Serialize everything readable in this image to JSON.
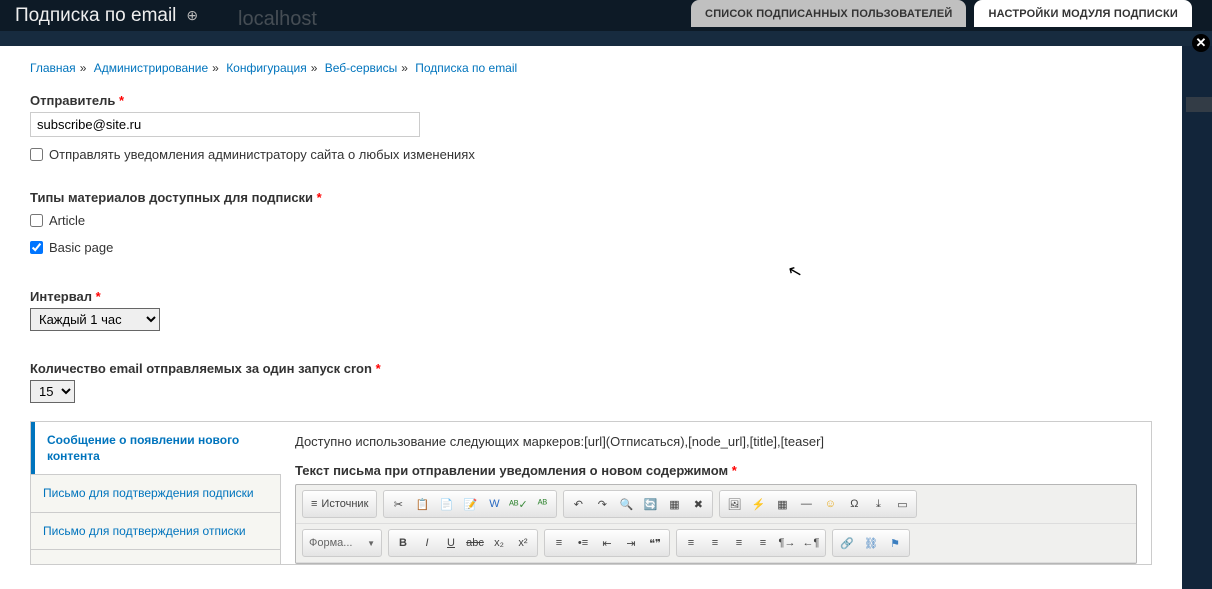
{
  "header": {
    "title": "Подписка по email",
    "plus_icon": "⊕",
    "host": "localhost",
    "tabs": [
      {
        "label": "СПИСОК ПОДПИСАННЫХ ПОЛЬЗОВАТЕЛЕЙ",
        "active": false
      },
      {
        "label": "НАСТРОЙКИ МОДУЛЯ ПОДПИСКИ",
        "active": true
      }
    ]
  },
  "breadcrumbs": [
    "Главная",
    "Администрирование",
    "Конфигурация",
    "Веб-сервисы",
    "Подписка по email"
  ],
  "sender": {
    "label": "Отправитель",
    "value": "subscribe@site.ru"
  },
  "notify_admin": {
    "label": "Отправлять уведомления администратору сайта о любых изменениях",
    "checked": false
  },
  "content_types": {
    "label": "Типы материалов доступных для подписки",
    "options": [
      {
        "label": "Article",
        "checked": false
      },
      {
        "label": "Basic page",
        "checked": true
      }
    ]
  },
  "interval": {
    "label": "Интервал",
    "selected": "Каждый 1 час"
  },
  "cron_count": {
    "label": "Количество email отправляемых за один запуск cron",
    "selected": "15"
  },
  "vertical_tabs": [
    "Сообщение о появлении нового контента",
    "Письмо для подтверждения подписки",
    "Письмо для подтверждения отписки"
  ],
  "tab_content": {
    "help": "Доступно использование следующих маркеров:[url](Отписаться),[node_url],[title],[teaser]",
    "editor_label": "Текст письма при отправлении уведомления о новом содержимом"
  },
  "ckeditor": {
    "source_label": "Источник",
    "format_label": "Форма..."
  }
}
